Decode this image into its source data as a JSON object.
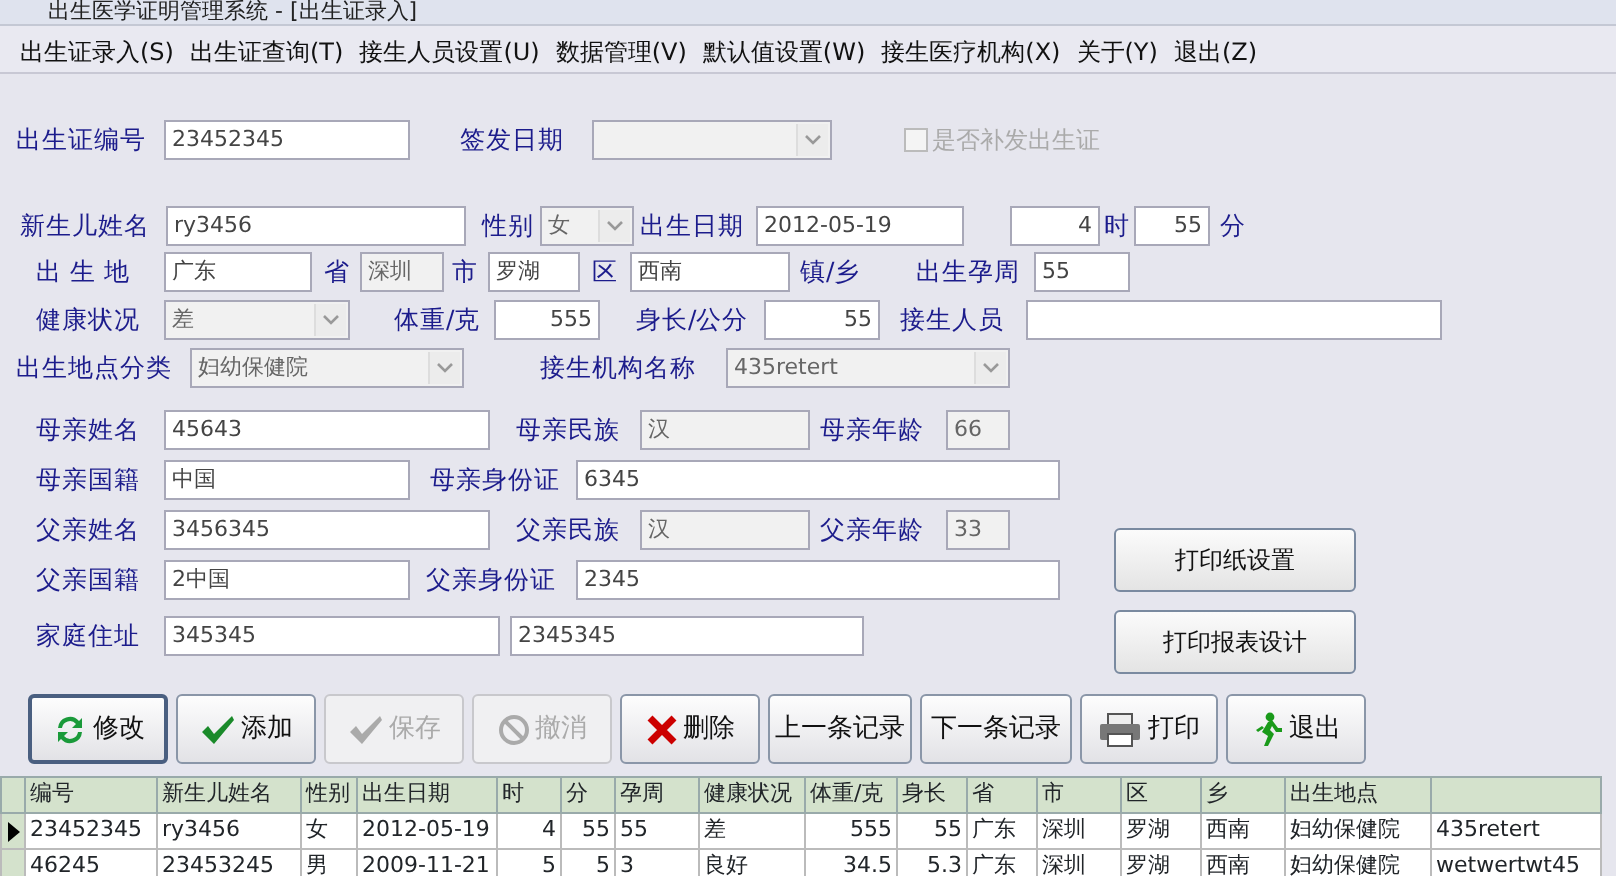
{
  "window": {
    "title": "出生医学证明管理系统  - [出生证录入]"
  },
  "menu": [
    "出生证录入(S)",
    "出生证查询(T)",
    "接生人员设置(U)",
    "数据管理(V)",
    "默认值设置(W)",
    "接生医疗机构(X)",
    "关于(Y)",
    "退出(Z)"
  ],
  "form_rows": [
    [
      {
        "kind": "label",
        "text": "出生证编号"
      },
      {
        "kind": "input",
        "value": "23452345",
        "disabled": false
      },
      {
        "kind": "label",
        "text": "签发日期"
      },
      {
        "kind": "select",
        "disabled": true
      },
      {
        "kind": "checkbox",
        "text": "是否补发出生证",
        "checked": false,
        "disabled": true
      }
    ],
    [
      {
        "kind": "label",
        "text": "新生儿姓名"
      },
      {
        "kind": "input",
        "value": "ry3456",
        "disabled": false
      },
      {
        "kind": "label",
        "text": "性别"
      },
      {
        "kind": "select",
        "value": "女",
        "disabled": true
      },
      {
        "kind": "label",
        "text": "出生日期"
      },
      {
        "kind": "input",
        "value": "2012-05-19",
        "disabled": false
      },
      {
        "kind": "input",
        "value": "4",
        "disabled": false
      },
      {
        "kind": "label",
        "text": "时"
      },
      {
        "kind": "input",
        "value": "55",
        "disabled": false
      },
      {
        "kind": "label",
        "text": "分"
      }
    ],
    [
      {
        "kind": "label",
        "text": "出 生 地"
      },
      {
        "kind": "input",
        "value": "广东",
        "disabled": false
      },
      {
        "kind": "label",
        "text": "省"
      },
      {
        "kind": "input",
        "value": "深圳",
        "disabled": true
      },
      {
        "kind": "label",
        "text": "市"
      },
      {
        "kind": "input",
        "value": "罗湖",
        "disabled": false
      },
      {
        "kind": "label",
        "text": "区"
      },
      {
        "kind": "input",
        "value": "西南",
        "disabled": false
      },
      {
        "kind": "label",
        "text": "镇/乡"
      },
      {
        "kind": "label",
        "text": "出生孕周"
      },
      {
        "kind": "input",
        "value": "55",
        "disabled": false
      }
    ],
    [
      {
        "kind": "label",
        "text": "健康状况"
      },
      {
        "kind": "select",
        "value": "差",
        "disabled": true
      },
      {
        "kind": "label",
        "text": "体重/克"
      },
      {
        "kind": "input",
        "value": "555",
        "disabled": false
      },
      {
        "kind": "label",
        "text": "身长/公分"
      },
      {
        "kind": "input",
        "value": "55",
        "disabled": false
      },
      {
        "kind": "label",
        "text": "接生人员"
      },
      {
        "kind": "input",
        "disabled": false
      }
    ],
    [
      {
        "kind": "label",
        "text": "出生地点分类"
      },
      {
        "kind": "select",
        "value": "妇幼保健院",
        "disabled": true
      },
      {
        "kind": "label",
        "text": "接生机构名称"
      },
      {
        "kind": "select",
        "value": "435retert",
        "disabled": true
      }
    ],
    [
      {
        "kind": "label",
        "text": "母亲姓名"
      },
      {
        "kind": "input",
        "value": "45643",
        "disabled": false
      },
      {
        "kind": "label",
        "text": "母亲民族"
      },
      {
        "kind": "input",
        "value": "汉",
        "disabled": true
      },
      {
        "kind": "label",
        "text": "母亲年龄"
      },
      {
        "kind": "input",
        "value": "66",
        "disabled": true
      }
    ],
    [
      {
        "kind": "label",
        "text": "母亲国籍"
      },
      {
        "kind": "input",
        "value": "中国",
        "disabled": false
      },
      {
        "kind": "label",
        "text": "母亲身份证"
      },
      {
        "kind": "input",
        "value": "6345",
        "disabled": false
      }
    ],
    [
      {
        "kind": "label",
        "text": "父亲姓名"
      },
      {
        "kind": "input",
        "value": "3456345",
        "disabled": false
      },
      {
        "kind": "label",
        "text": "父亲民族"
      },
      {
        "kind": "input",
        "value": "汉",
        "disabled": true
      },
      {
        "kind": "label",
        "text": "父亲年龄"
      },
      {
        "kind": "input",
        "value": "33",
        "disabled": true
      }
    ],
    [
      {
        "kind": "label",
        "text": "父亲国籍"
      },
      {
        "kind": "input",
        "value": "2中国",
        "disabled": false
      },
      {
        "kind": "label",
        "text": "父亲身份证"
      },
      {
        "kind": "input",
        "value": "2345",
        "disabled": false
      }
    ],
    [
      {
        "kind": "label",
        "text": "家庭住址"
      },
      {
        "kind": "input",
        "value": "345345",
        "disabled": false
      },
      {
        "kind": "input",
        "value": "2345345",
        "disabled": false
      }
    ]
  ],
  "side_buttons": [
    "打印纸设置",
    "打印报表设计"
  ],
  "toolbar": [
    {
      "label": "修改",
      "disabled": false,
      "focused": true
    },
    {
      "label": "添加",
      "disabled": false,
      "focused": false
    },
    {
      "label": "保存",
      "disabled": true,
      "focused": false
    },
    {
      "label": "撤消",
      "disabled": true,
      "focused": false
    },
    {
      "label": "删除",
      "disabled": false,
      "focused": false
    },
    {
      "label": "上一条记录",
      "disabled": false,
      "focused": false
    },
    {
      "label": "下一条记录",
      "disabled": false,
      "focused": false
    },
    {
      "label": "打印",
      "disabled": false,
      "focused": false
    },
    {
      "label": "退出",
      "disabled": false,
      "focused": false
    }
  ],
  "table": {
    "columns": [
      "编号",
      "新生儿姓名",
      "性别",
      "出生日期",
      "时",
      "分",
      "孕周",
      "健康状况",
      "体重/克",
      "身长",
      "省",
      "市",
      "区",
      "乡",
      "出生地点"
    ],
    "rows": [
      {
        "selected": true,
        "cells": [
          "23452345",
          "ry3456",
          "女",
          "2012-05-19",
          "4",
          "55",
          "55",
          "差",
          "555",
          "55",
          "广东",
          "深圳",
          "罗湖",
          "西南",
          "妇幼保健院",
          "435retert"
        ]
      },
      {
        "selected": false,
        "cells": [
          "46245",
          "23453245",
          "男",
          "2009-11-21",
          "5",
          "5",
          "3",
          "良好",
          "34.5",
          "5.3",
          "广东",
          "深圳",
          "罗湖",
          "西南",
          "妇幼保健院",
          "wetwertwt45"
        ]
      }
    ]
  }
}
